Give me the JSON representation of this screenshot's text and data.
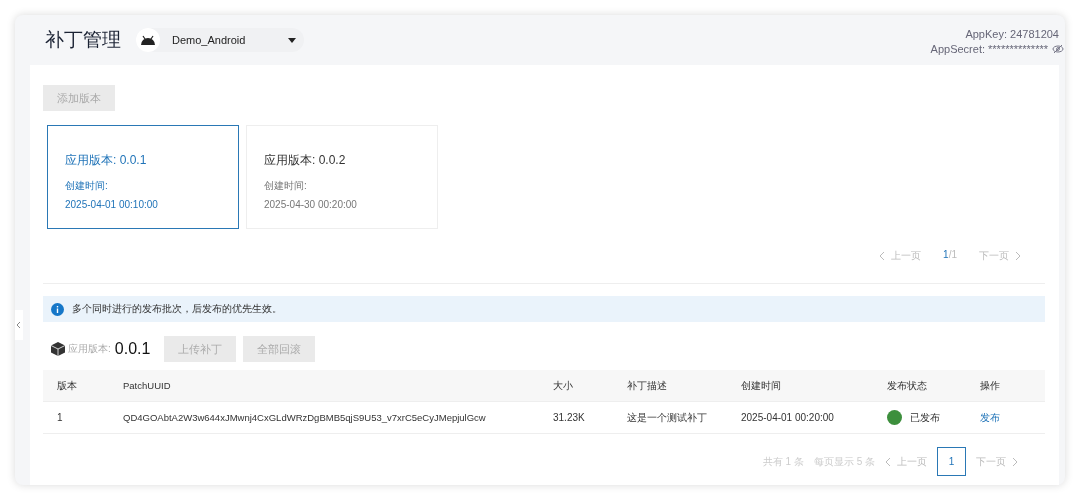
{
  "header": {
    "title": "补丁管理",
    "app_select": {
      "value": "Demo_Android"
    },
    "app_key": "AppKey: 24781204",
    "app_secret": "AppSecret: **************"
  },
  "add_version_button": {
    "label": "添加版本",
    "disabled": true
  },
  "versions": [
    {
      "title": "应用版本: 0.0.1",
      "created_label": "创建时间:",
      "created": "2025-04-01 00:10:00",
      "selected": true
    },
    {
      "title": "应用版本: 0.0.2",
      "created_label": "创建时间:",
      "created": "2025-04-30 00:20:00",
      "selected": false
    }
  ],
  "version_pager": {
    "prev": "上一页",
    "page": "1",
    "total": "/1",
    "next": "下一页"
  },
  "notice": "多个同时进行的发布批次，后发布的优先生效。",
  "patch_toolbar": {
    "label": "应用版本:",
    "version": "0.0.1",
    "buttons": [
      {
        "label": "上传补丁",
        "disabled": true
      },
      {
        "label": "全部回滚",
        "disabled": true
      }
    ]
  },
  "table": {
    "columns": [
      "版本",
      "PatchUUID",
      "大小",
      "补丁描述",
      "创建时间",
      "发布状态",
      "操作"
    ],
    "rows": [
      {
        "version": "1",
        "uuid": "QD4GOAbtA2W3w644xJMwnj4CxGLdWRzDgBMB5qjS9U53_v7xrC5eCyJMepjulGcw",
        "size": "31.23K",
        "description": "这是一个测试补丁",
        "created": "2025-04-01 00:20:00",
        "status": "已发布",
        "color": "#3d8f3d",
        "action": "发布"
      }
    ]
  },
  "table_pager": {
    "total": "共有 1 条",
    "per_page": "每页显示 5 条",
    "prev": "上一页",
    "pages": [
      {
        "label": "1",
        "selected": true
      }
    ],
    "next": "下一页"
  }
}
